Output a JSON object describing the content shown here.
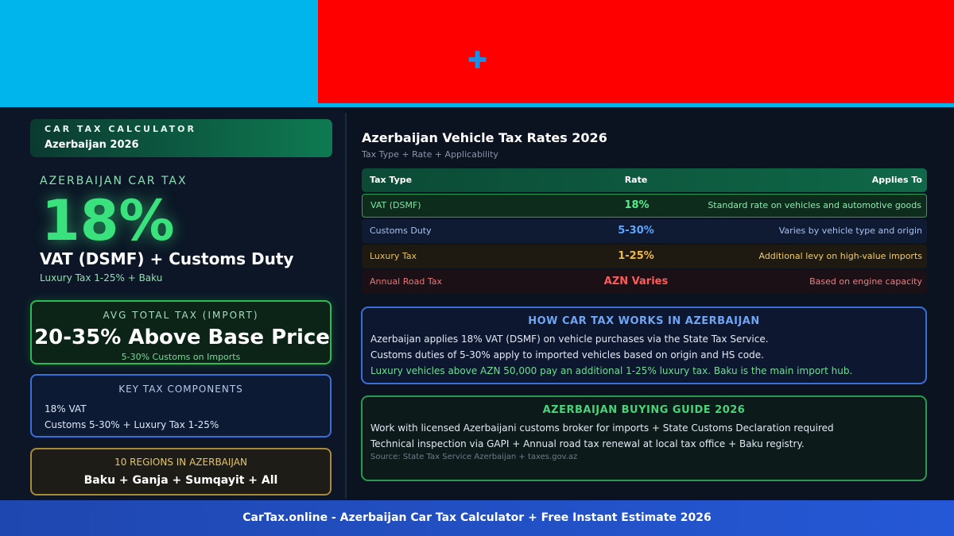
{
  "colors": {
    "flag_blue": "#00b5ec",
    "flag_red": "#ff0000",
    "accent_green": "#39e27d",
    "accent_blue": "#3a6fd8",
    "accent_gold": "#a88a38",
    "footer_blue": "#2558d6"
  },
  "flag": {
    "symbol_icon": "crescent-star-icon",
    "symbol_glyph": "✚"
  },
  "brand": {
    "kicker": "CAR TAX CALCULATOR",
    "subtitle": "Azerbaijan 2026"
  },
  "hero": {
    "label": "AZERBAIJAN CAR TAX",
    "value": "18%",
    "main": "VAT (DSMF) + Customs Duty",
    "sub": "Luxury Tax 1-25% + Baku"
  },
  "avg_total": {
    "label": "AVG TOTAL TAX (IMPORT)",
    "value": "20-35% Above Base Price",
    "sub": "5-30% Customs on Imports"
  },
  "key_components": {
    "title": "KEY TAX COMPONENTS",
    "line1": "18% VAT",
    "line2": "Customs 5-30% + Luxury Tax 1-25%"
  },
  "regions": {
    "title": "10 REGIONS IN AZERBAIJAN",
    "list": "Baku + Ganja + Sumqayit + All"
  },
  "rates": {
    "title": "Azerbaijan Vehicle Tax Rates 2026",
    "subtitle": "Tax Type + Rate + Applicability",
    "headers": {
      "type": "Tax Type",
      "rate": "Rate",
      "applies": "Applies To"
    },
    "rows": [
      {
        "type": "VAT (DSMF)",
        "rate": "18%",
        "applies": "Standard rate on vehicles and automotive goods"
      },
      {
        "type": "Customs Duty",
        "rate": "5-30%",
        "applies": "Varies by vehicle type and origin"
      },
      {
        "type": "Luxury Tax",
        "rate": "1-25%",
        "applies": "Additional levy on high-value imports"
      },
      {
        "type": "Annual Road Tax",
        "rate": "AZN Varies",
        "applies": "Based on engine capacity"
      }
    ]
  },
  "how": {
    "title": "HOW CAR TAX WORKS IN AZERBAIJAN",
    "line1": "Azerbaijan applies 18% VAT (DSMF) on vehicle purchases via the State Tax Service.",
    "line2": "Customs duties of 5-30% apply to imported vehicles based on origin and HS code.",
    "line3": "Luxury vehicles above AZN 50,000 pay an additional 1-25% luxury tax. Baku is the main import hub."
  },
  "guide": {
    "title": "AZERBAIJAN BUYING GUIDE 2026",
    "line1": "Work with licensed Azerbaijani customs broker for imports + State Customs Declaration required",
    "line2": "Technical inspection via GAPI + Annual road tax renewal at local tax office + Baku registry.",
    "source": "Source: State Tax Service Azerbaijan + taxes.gov.az"
  },
  "footer": {
    "text": "CarTax.online - Azerbaijan Car Tax Calculator + Free Instant Estimate 2026"
  }
}
